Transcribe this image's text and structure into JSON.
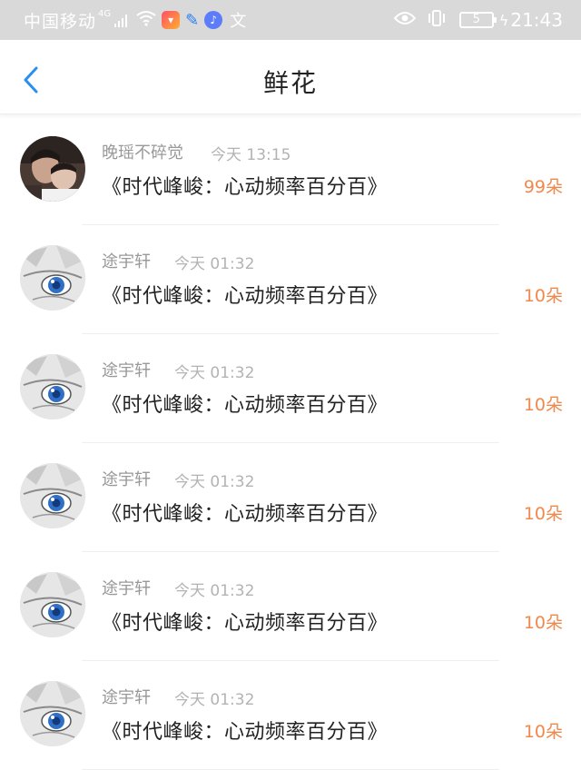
{
  "status_bar": {
    "carrier": "中国移动",
    "network": "4G",
    "time": "21:43",
    "battery": "5",
    "ime_glyph": "文"
  },
  "nav": {
    "title": "鲜花"
  },
  "colors": {
    "accent_blue": "#2b8ef3",
    "count_orange": "#f0884b",
    "status_bar_bg": "#d9d9d9"
  },
  "items": [
    {
      "user": "晚瑶不碎觉",
      "time": "今天 13:15",
      "title": "《时代峰峻：心动频率百分百》",
      "count": "99朵",
      "avatar": "photo-avatar"
    },
    {
      "user": "途宇轩",
      "time": "今天 01:32",
      "title": "《时代峰峻：心动频率百分百》",
      "count": "10朵",
      "avatar": "anime-eye-avatar"
    },
    {
      "user": "途宇轩",
      "time": "今天 01:32",
      "title": "《时代峰峻：心动频率百分百》",
      "count": "10朵",
      "avatar": "anime-eye-avatar"
    },
    {
      "user": "途宇轩",
      "time": "今天 01:32",
      "title": "《时代峰峻：心动频率百分百》",
      "count": "10朵",
      "avatar": "anime-eye-avatar"
    },
    {
      "user": "途宇轩",
      "time": "今天 01:32",
      "title": "《时代峰峻：心动频率百分百》",
      "count": "10朵",
      "avatar": "anime-eye-avatar"
    },
    {
      "user": "途宇轩",
      "time": "今天 01:32",
      "title": "《时代峰峻：心动频率百分百》",
      "count": "10朵",
      "avatar": "anime-eye-avatar"
    }
  ]
}
